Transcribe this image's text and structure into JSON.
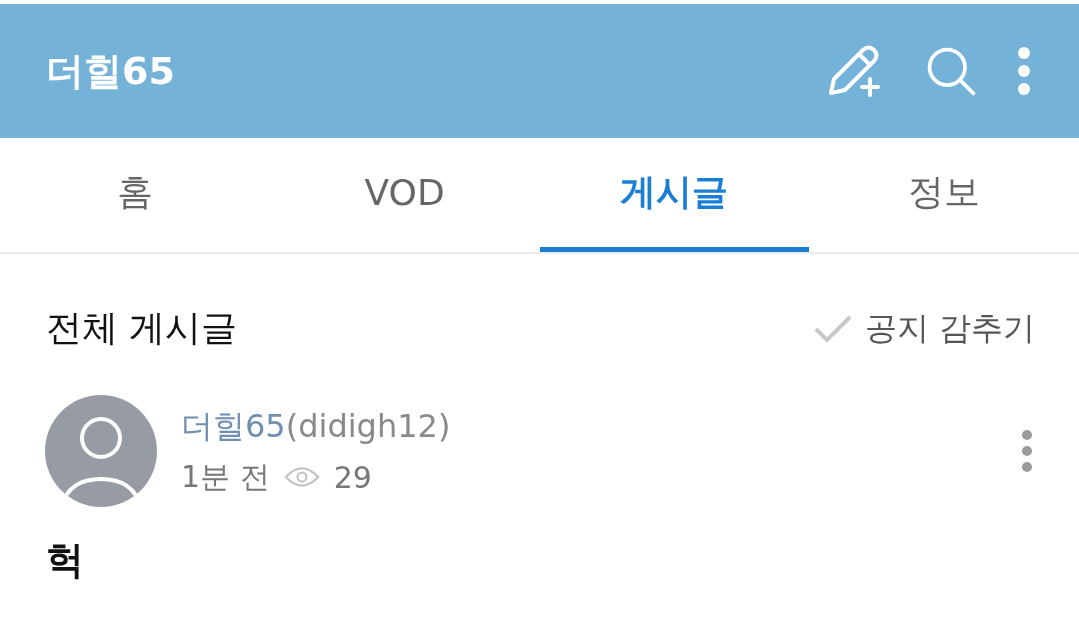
{
  "header": {
    "title": "더힐65"
  },
  "tabs": [
    {
      "label": "홈",
      "selected": false
    },
    {
      "label": "VOD",
      "selected": false
    },
    {
      "label": "게시글",
      "selected": true
    },
    {
      "label": "정보",
      "selected": false
    }
  ],
  "section": {
    "title": "전체 게시글",
    "hide_notice": {
      "label": "공지 감추기",
      "checked": false
    }
  },
  "post": {
    "author_name": "더힐65",
    "author_id": "(didigh12)",
    "time": "1분 전",
    "views": "29",
    "title": "헉"
  }
}
